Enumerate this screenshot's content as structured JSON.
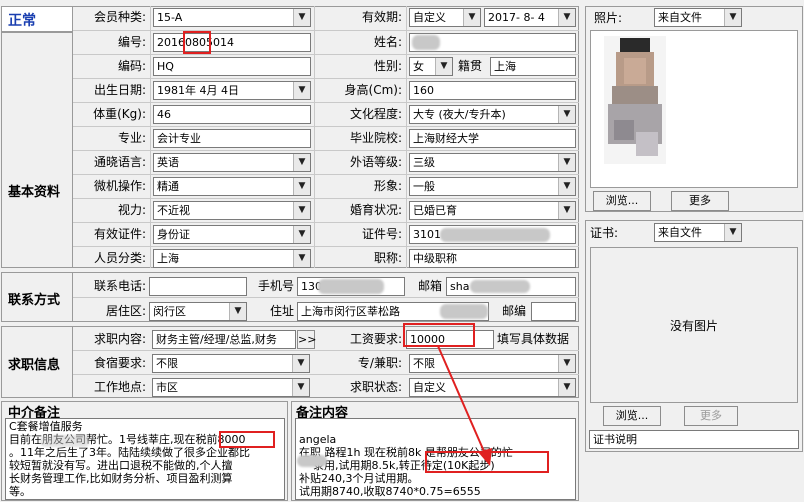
{
  "status": "正常",
  "sections": {
    "basic": "基本资料",
    "contact": "联系方式",
    "job": "求职信息",
    "agent_note": "中介备注",
    "remarks": "备注内容"
  },
  "basic": {
    "member_type_label": "会员种类:",
    "member_type": "15-A",
    "validity_label": "有效期:",
    "validity_type": "自定义",
    "validity_date": "2017- 8- 4",
    "number_label": "编号:",
    "number": "20160805014",
    "name_label": "姓名:",
    "code_label": "编码:",
    "code": "HQ",
    "gender_label": "性别:",
    "gender": "女",
    "native_label": "籍贯",
    "native": "上海",
    "birth_label": "出生日期:",
    "birth": "1981年 4月 4日",
    "height_label": "身高(Cm):",
    "height": "160",
    "weight_label": "体重(Kg):",
    "weight": "46",
    "education_label": "文化程度:",
    "education": "大专 (夜大/专升本)",
    "major_label": "专业:",
    "major": "会计专业",
    "school_label": "毕业院校:",
    "school": "上海财经大学",
    "language_label": "通晓语言:",
    "language": "英语",
    "language_level_label": "外语等级:",
    "language_level": "三级",
    "computer_label": "微机操作:",
    "computer": "精通",
    "appearance_label": "形象:",
    "appearance": "一般",
    "vision_label": "视力:",
    "vision": "不近视",
    "marital_label": "婚育状况:",
    "marital": "已婚已育",
    "cert_label": "有效证件:",
    "cert": "身份证",
    "cert_no_label": "证件号:",
    "cert_no": "3101",
    "category_label": "人员分类:",
    "category": "上海",
    "title_label": "职称:",
    "title": "中级职称"
  },
  "contact": {
    "phone_label": "联系电话:",
    "mobile_label": "手机号",
    "mobile": "130",
    "email_label": "邮箱",
    "email": "sha",
    "district_label": "居住区:",
    "district": "闵行区",
    "address_label": "住址",
    "address": "上海市闵行区莘松路",
    "postcode_label": "邮编"
  },
  "job": {
    "content_label": "求职内容:",
    "content": "财务主管/经理/总监,财务",
    "more_button": ">>",
    "salary_label": "工资要求:",
    "salary": "10000",
    "salary_hint": "填写具体数据",
    "board_label": "食宿要求:",
    "board": "不限",
    "parttime_label": "专/兼职:",
    "parttime": "不限",
    "location_label": "工作地点:",
    "location": "市区",
    "job_status_label": "求职状态:",
    "job_status": "自定义"
  },
  "photo": {
    "label": "照片:",
    "source": "来自文件",
    "browse": "浏览...",
    "more": "更多"
  },
  "certificate": {
    "label": "证书:",
    "source": "来自文件",
    "no_image": "没有图片",
    "browse": "浏览...",
    "more": "更多",
    "desc": "证书说明"
  },
  "agent_note_text": "C套餐增值服务\n目前在朋友公司帮忙。1号线莘庄,现在税前8000\n。11年之后生了3年。陆陆续续做了很多企业都比\n较短暂就没有写。进出口退税不能做的,个人擅\n长财务管理工作,比如财务分析、项目盈利测算\n等。",
  "remark_lines": [
    "angela",
    "在职 路程1h 现在税前8k 是帮朋友公司的忙",
    "",
    "    录用,试用期8.5k,转正待定(10K起步)",
    "补贴240,3个月试用期。",
    "试用期8740,收取8740*0.75=6555"
  ]
}
